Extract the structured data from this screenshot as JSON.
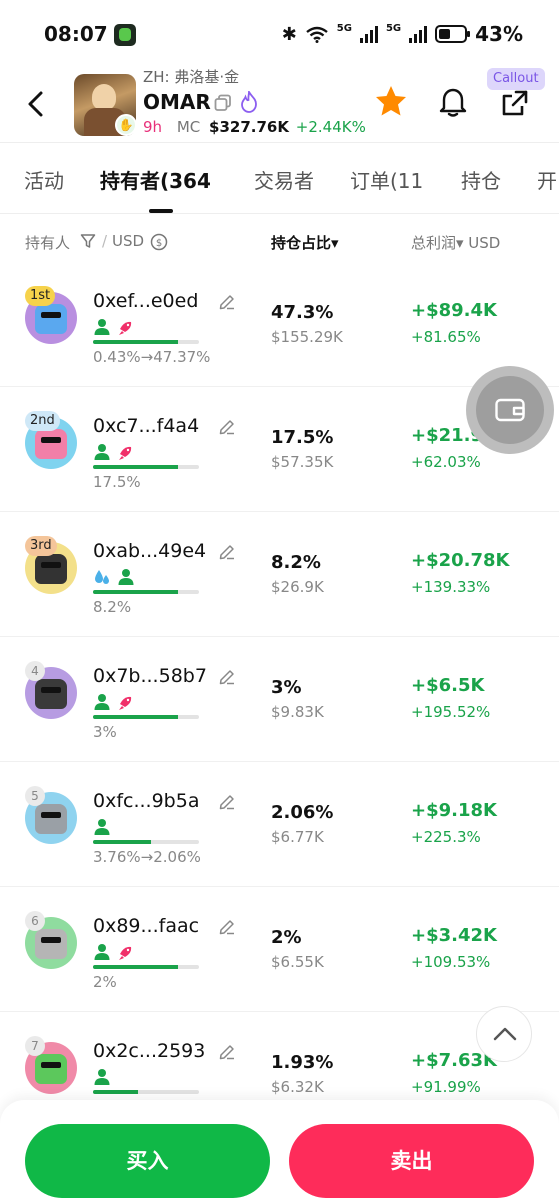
{
  "status_bar": {
    "time": "08:07",
    "network": "5G",
    "network2": "5G",
    "battery": "43%"
  },
  "header": {
    "sub_name": "ZH: 弗洛基·金",
    "token_name": "OMAR",
    "age": "9h",
    "mc_label": "MC",
    "mc_value": "$327.76K",
    "mc_change": "+2.44K%",
    "callout": "Callout",
    "icons": [
      "back-icon",
      "copy-icon",
      "flame-icon",
      "star-icon",
      "bell-icon",
      "share-icon"
    ]
  },
  "tabs": [
    {
      "label": "活动"
    },
    {
      "label": "持有者",
      "count": "(364"
    },
    {
      "label": "交易者"
    },
    {
      "label": "订单",
      "count": "(11"
    },
    {
      "label": "持仓"
    },
    {
      "label": "开"
    }
  ],
  "columns": {
    "holder": "持有人",
    "sep": "/",
    "usd": "USD",
    "share": "持仓占比▾",
    "profit": "总利润▾ USD"
  },
  "holders": [
    {
      "rank": "1st",
      "address": "0xef...e0ed",
      "history": "0.43%→47.37%",
      "bar": 0.8,
      "pct": "47.3%",
      "value": "$155.29K",
      "pnl": "+$89.4K",
      "roi": "+81.65%",
      "avatar_bg": "#b98fe0",
      "figure": "#5aa8ef",
      "rank_bg": "#f6d24b",
      "tags": [
        "user-icon",
        "fish-icon"
      ]
    },
    {
      "rank": "2nd",
      "address": "0xc7...f4a4",
      "history": "17.5%",
      "bar": 0.8,
      "pct": "17.5%",
      "value": "$57.35K",
      "pnl": "+$21.96K",
      "roi": "+62.03%",
      "avatar_bg": "#7fd3ef",
      "figure": "#f27fa8",
      "rank_bg": "#cfe8f7",
      "tags": [
        "user-icon",
        "fish-icon"
      ]
    },
    {
      "rank": "3rd",
      "address": "0xab...49e4",
      "history": "8.2%",
      "bar": 0.8,
      "pct": "8.2%",
      "value": "$26.9K",
      "pnl": "+$20.78K",
      "roi": "+139.33%",
      "avatar_bg": "#f3e08a",
      "figure": "#333333",
      "rank_bg": "#f4c59a",
      "tags": [
        "droplet-icon",
        "user-icon"
      ]
    },
    {
      "rank": "4",
      "address": "0x7b...58b7",
      "history": "3%",
      "bar": 0.8,
      "pct": "3%",
      "value": "$9.83K",
      "pnl": "+$6.5K",
      "roi": "+195.52%",
      "avatar_bg": "#b79ce2",
      "figure": "#3a3a3a",
      "rank_bg": "#eaeaea",
      "tags": [
        "user-icon",
        "fish-icon"
      ]
    },
    {
      "rank": "5",
      "address": "0xfc...9b5a",
      "history": "3.76%→2.06%",
      "bar": 0.55,
      "pct": "2.06%",
      "value": "$6.77K",
      "pnl": "+$9.18K",
      "roi": "+225.3%",
      "avatar_bg": "#8fd3ef",
      "figure": "#9aa0a6",
      "rank_bg": "#eaeaea",
      "tags": [
        "user-icon"
      ]
    },
    {
      "rank": "6",
      "address": "0x89...faac",
      "history": "2%",
      "bar": 0.8,
      "pct": "2%",
      "value": "$6.55K",
      "pnl": "+$3.42K",
      "roi": "+109.53%",
      "avatar_bg": "#8fdc9f",
      "figure": "#b5b5b5",
      "rank_bg": "#eaeaea",
      "tags": [
        "user-icon",
        "fish-icon"
      ]
    },
    {
      "rank": "7",
      "address": "0x2c...2593",
      "history": "",
      "bar": 0.42,
      "pct": "1.93%",
      "value": "$6.32K",
      "pnl": "+$7.63K",
      "roi": "+91.99%",
      "avatar_bg": "#f08aa8",
      "figure": "#5cc85c",
      "rank_bg": "#eaeaea",
      "tags": [
        "user-icon"
      ]
    }
  ],
  "actions": {
    "buy": "买入",
    "sell": "卖出"
  },
  "colors": {
    "green": "#1aa34a",
    "buy": "#10b847",
    "sell": "#fe2c5a",
    "callout": "#7a55e6"
  }
}
